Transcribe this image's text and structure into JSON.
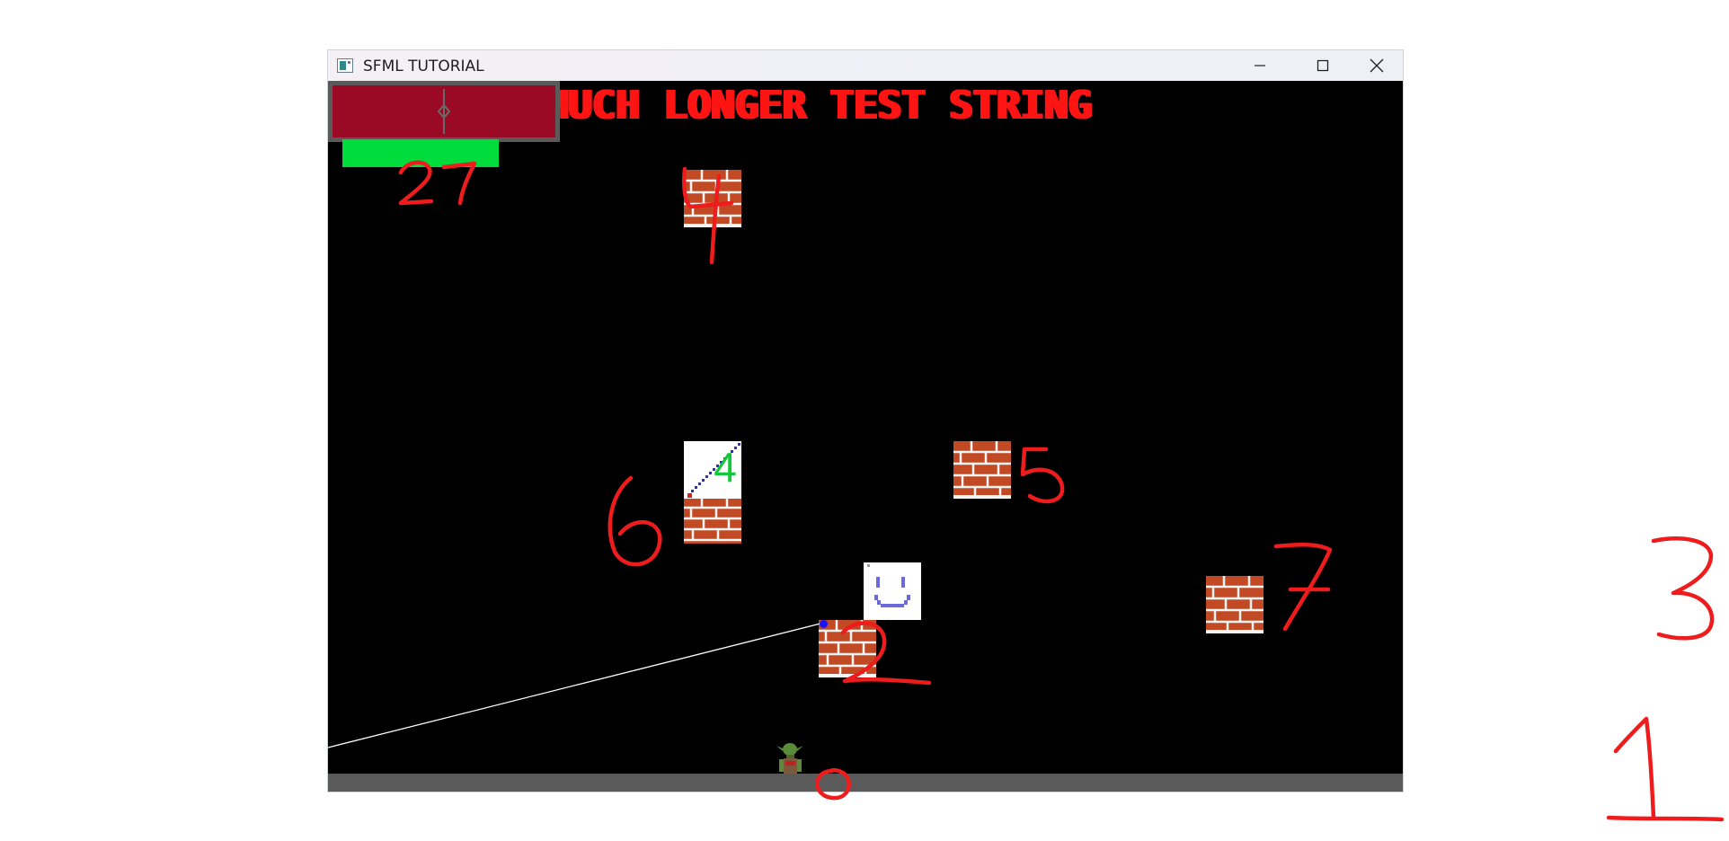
{
  "window": {
    "title": "SFML TUTORIAL",
    "icon": "app-icon",
    "controls": [
      "minimize-icon",
      "maximize-icon",
      "close-icon"
    ]
  },
  "game": {
    "banner_text": "MUCH LONGER TEST STRING",
    "health_fraction": 0.88,
    "colors": {
      "background": "#000000",
      "banner": "#ff1414",
      "hud_box": "#9b0a24",
      "health_bar": "#00dc3c",
      "ground": "#5a5a5a",
      "ray": "#ffffff"
    },
    "tiles": [
      {
        "kind": "brick",
        "icon": "brick-tile"
      },
      {
        "kind": "numbered",
        "label": "4",
        "icon": "numbered-tile"
      },
      {
        "kind": "brick",
        "icon": "brick-tile"
      },
      {
        "kind": "brick",
        "icon": "brick-tile"
      },
      {
        "kind": "smiley",
        "icon": "smiley-tile"
      },
      {
        "kind": "brick",
        "icon": "brick-tile"
      },
      {
        "kind": "brick",
        "icon": "brick-tile"
      }
    ],
    "player": "goblin-player"
  },
  "annotations": {
    "color": "#ee1c1c",
    "numbers": [
      "27",
      "4",
      "6",
      "5",
      "7",
      "2",
      "0",
      "3",
      "1"
    ]
  }
}
